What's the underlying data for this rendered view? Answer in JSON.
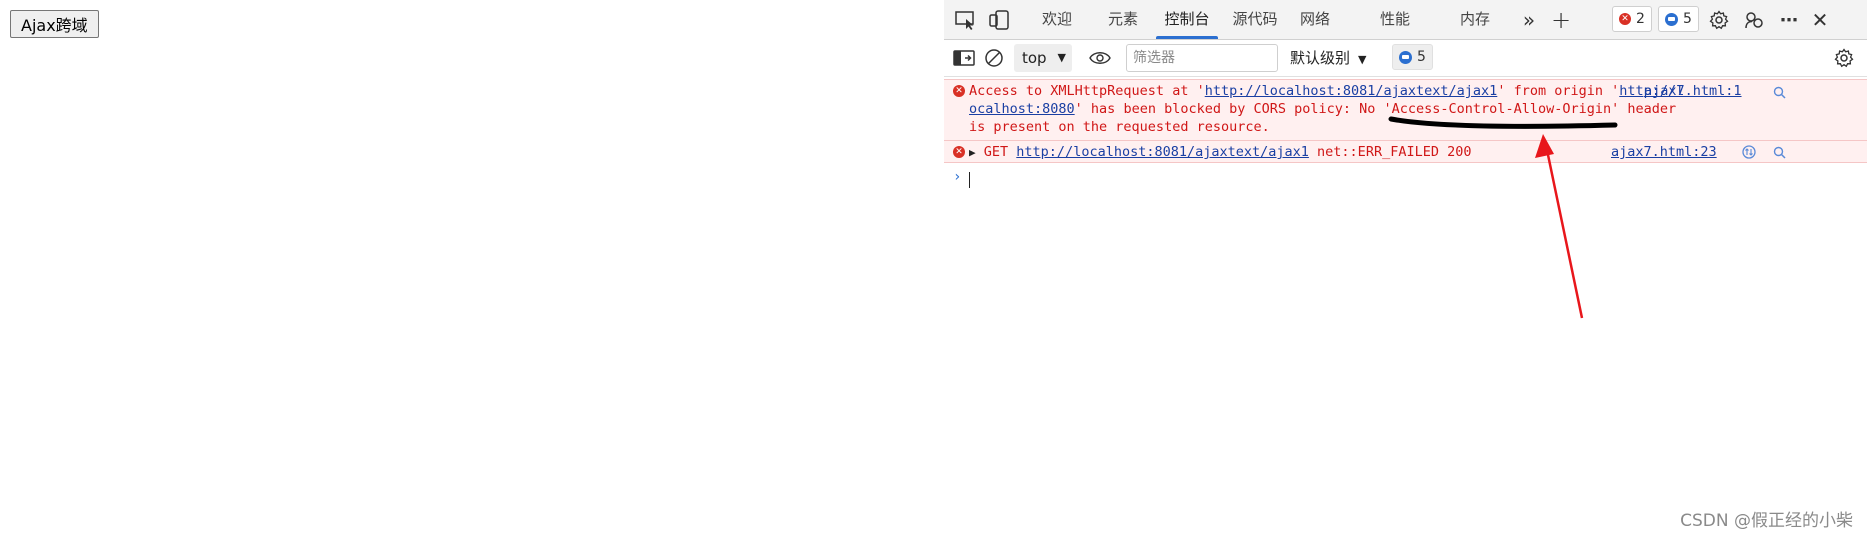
{
  "page": {
    "button_label": "Ajax跨域"
  },
  "devtools": {
    "tabs": [
      {
        "label": "欢迎"
      },
      {
        "label": "元素"
      },
      {
        "label": "控制台"
      },
      {
        "label": "源代码"
      },
      {
        "label": "网络"
      },
      {
        "label": "性能"
      },
      {
        "label": "内存"
      }
    ],
    "active_tab": "控制台",
    "error_count": "2",
    "message_count": "5",
    "toolbar": {
      "context": "top",
      "filter_placeholder": "筛选器",
      "levels": "默认级别",
      "message_count": "5"
    },
    "messages": [
      {
        "line1_pre": "Access to XMLHttpRequest at '",
        "url1": "http://localhost:8081/ajaxtext/ajax1",
        "line1_mid": "' from origin '",
        "origin_part1": "http://l",
        "origin_part2": "ocalhost:8080",
        "line2_post": "' has been blocked by CORS policy: No 'Access-Control-Allow-Origin' header",
        "line3": "is present on the requested resource.",
        "source": "ajax7.html:1"
      },
      {
        "method": "GET",
        "url": "http://localhost:8081/ajaxtext/ajax1",
        "status": "net::ERR_FAILED 200",
        "source": "ajax7.html:23"
      }
    ]
  },
  "watermark": "CSDN @假正经的小柴",
  "colors": {
    "error_text": "#d01717",
    "error_bg": "#fff0f0",
    "link": "#1a3fa3",
    "accent": "#2b6fd0",
    "annotation": "#e8161b"
  }
}
